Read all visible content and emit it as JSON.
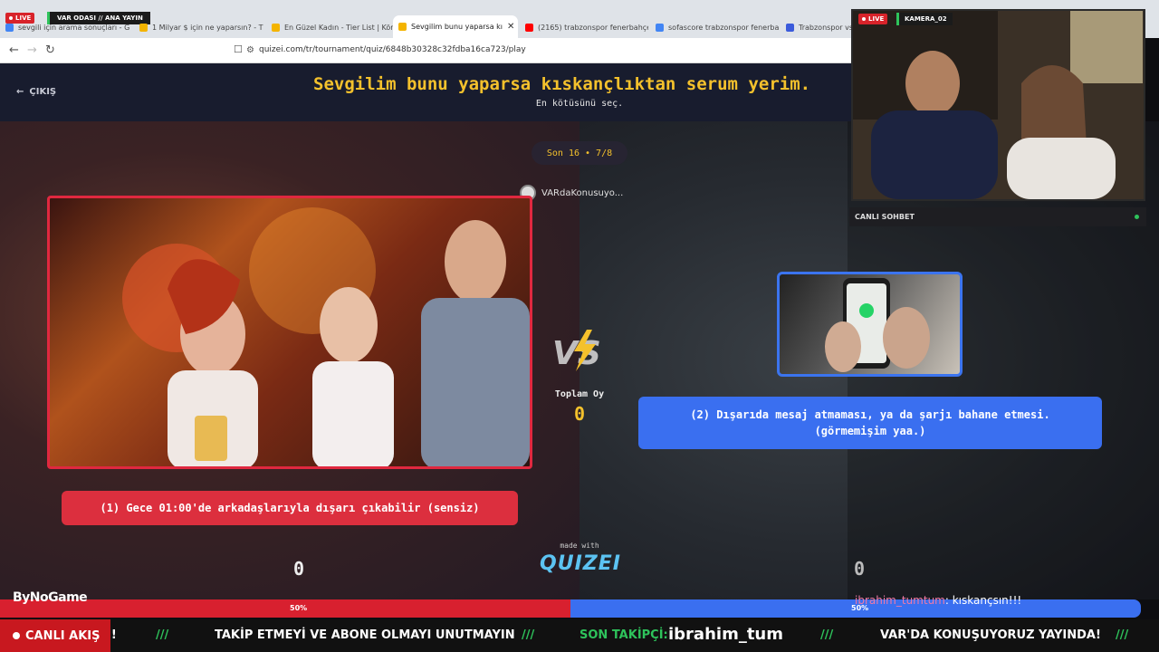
{
  "browser": {
    "stream_badge": "LIVE",
    "stream_title": "VAR ODASI // ANA YAYIN",
    "tabs": [
      {
        "label": "sevgili için arama sonuçları - G",
        "color": "#4285f4"
      },
      {
        "label": "1 Milyar $ için ne yaparsın? - T",
        "color": "#f4b400"
      },
      {
        "label": "En Güzel Kadın - Tier List | Kör",
        "color": "#f4b400"
      },
      {
        "label": "Sevgilim bunu yaparsa kı",
        "color": "#f4b400"
      },
      {
        "label": "(2165) trabzonspor fenerbahçe",
        "color": "#ff0000"
      },
      {
        "label": "sofascore trabzonspor fenerbahçe",
        "color": "#4285f4"
      },
      {
        "label": "Trabzonspor vs Fe",
        "color": "#3b5bdb"
      }
    ],
    "url": "quizei.com/tr/tournament/quiz/6848b30328c32fdba16ca723/play"
  },
  "quiz": {
    "exit_label": "ÇIKIŞ",
    "title": "Sevgilim bunu yaparsa kıskançlıktan serum yerim.",
    "subtitle": "En kötüsünü seç.",
    "round": "Son 16 • 7/8",
    "user": "VARdaKonusuyo...",
    "total_label": "Toplam Oy",
    "total_value": "0",
    "option_left": "(1) Gece 01:00'de arkadaşlarıyla dışarı çıkabilir (sensiz)",
    "option_right_line1": "(2) Dışarıda mesaj atmaması, ya da şarjı bahane etmesi.",
    "option_right_line2": "(görmemişim yaa.)",
    "made_with": "made with",
    "brand": "QUIZEI",
    "score_left": "0",
    "score_right": "0",
    "percent_left": "50%",
    "percent_right": "50%",
    "vote_share_left": 0.5,
    "colors": {
      "accent": "#f4c12c",
      "left": "#dc2f3e",
      "right": "#3a6ff0"
    }
  },
  "overlay": {
    "cam_badge": "LIVE",
    "cam_label": "KAMERA_02",
    "chat_header": "CANLI SOHBET",
    "chat_user": "ibrahim_tumtum",
    "chat_message": ": kıskançsın!!!",
    "sponsor": "ByNoGame"
  },
  "ticker": {
    "live_label": "CANLI AKIŞ",
    "fragment": "N!",
    "sep": "///",
    "msg1": "TAKİP ETMEYİ VE ABONE OLMAYI UNUTMAYIN",
    "follower_label": "SON TAKİPÇİ:",
    "follower_name": "ibrahim_tum",
    "msg2": "VAR'DA KONUŞUYORUZ YAYINDA!"
  }
}
